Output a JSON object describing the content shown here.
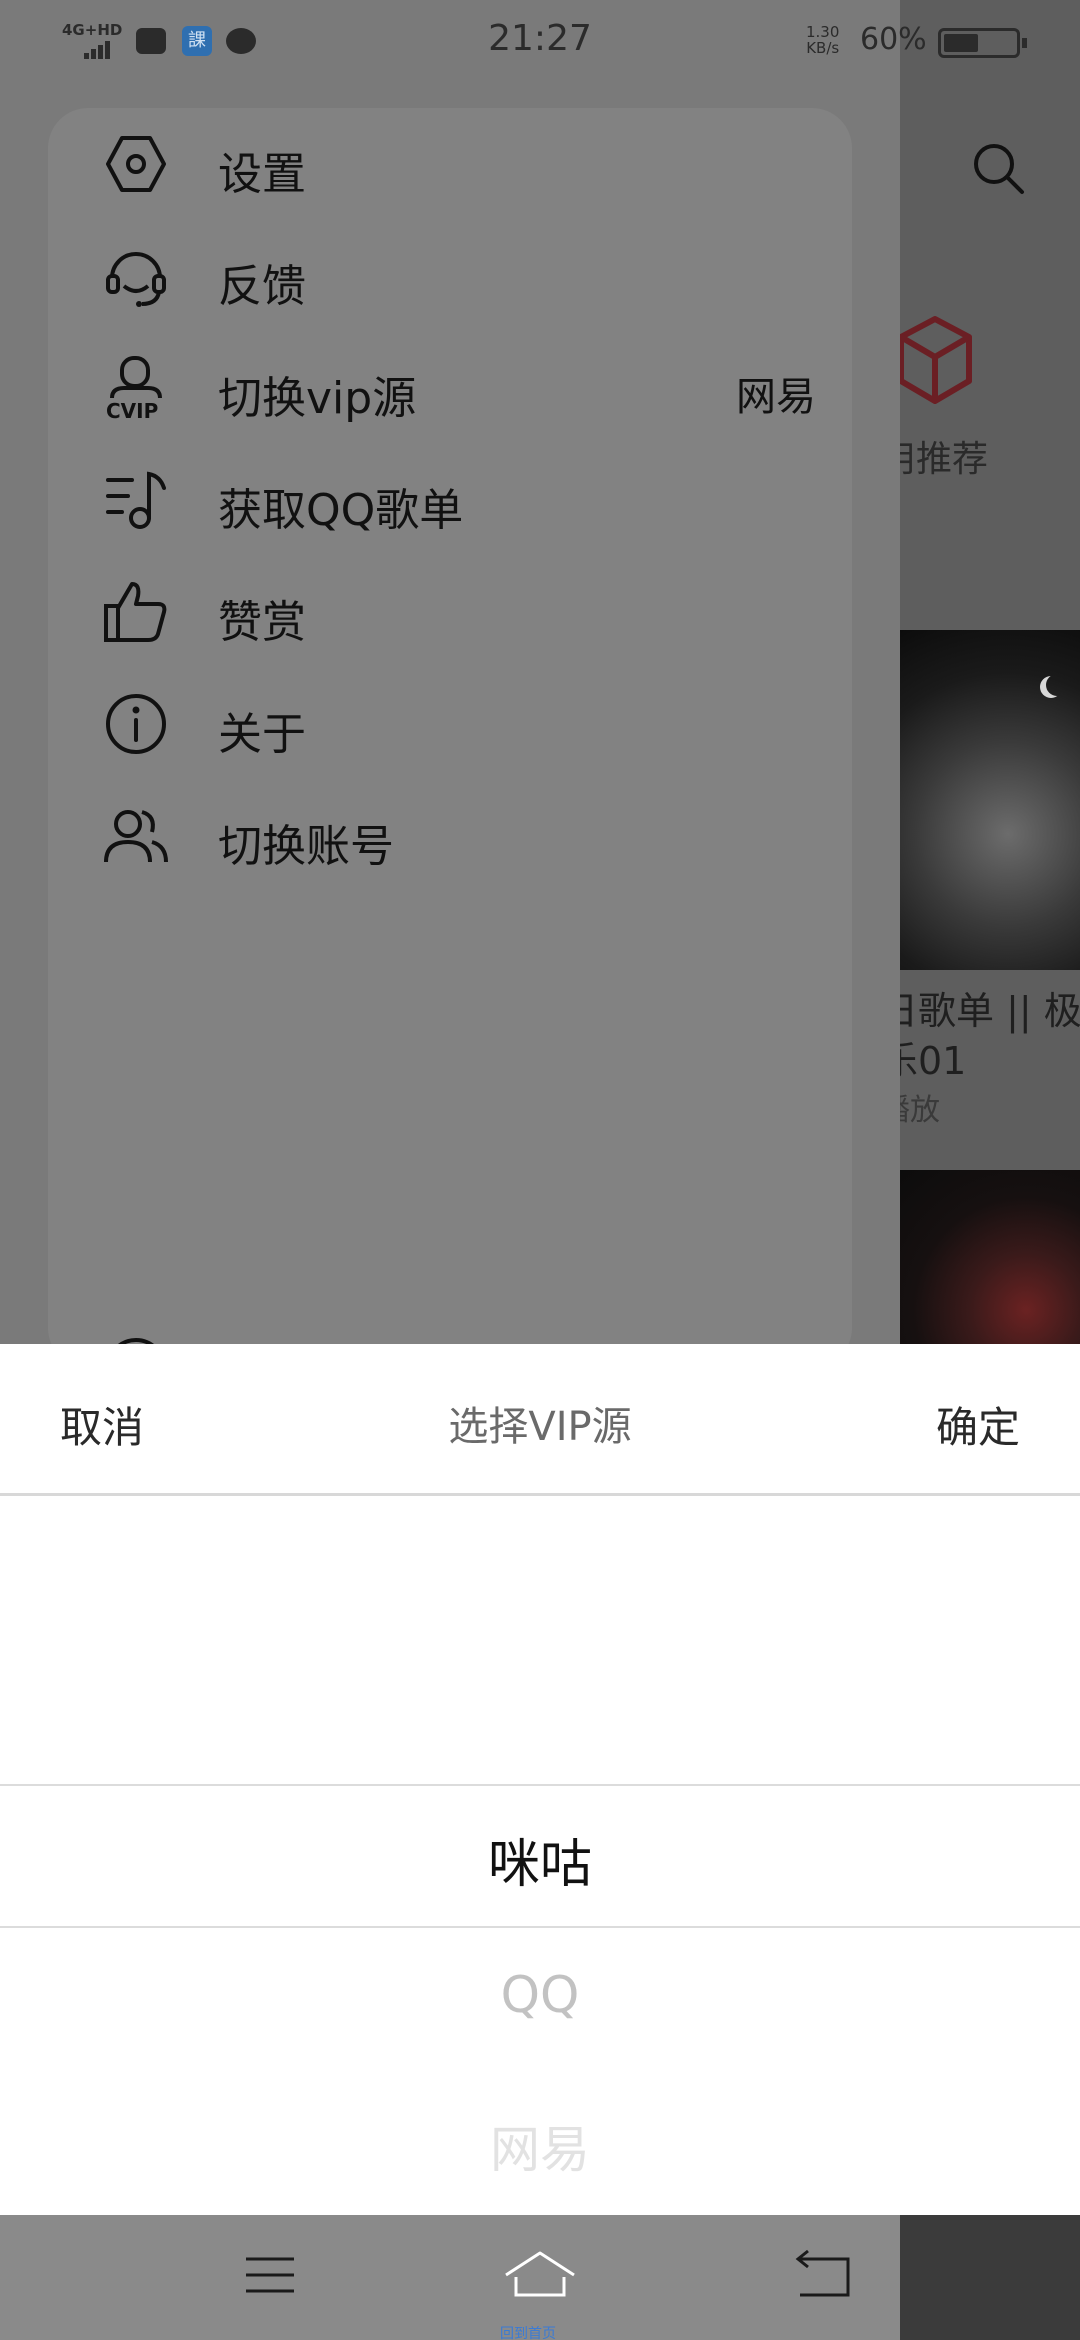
{
  "status_bar": {
    "network": "4G+HD",
    "time": "21:27",
    "speed_value": "1.30",
    "speed_unit": "KB/s",
    "battery_percent": "60%",
    "app_icon_label": "課"
  },
  "background": {
    "recommend_label": "用推荐",
    "playlist_title": "日歌单 || 极静",
    "playlist_sub": "乐01",
    "playlist_play": "播放"
  },
  "drawer": {
    "items": [
      {
        "label": "设置",
        "icon": "hexagon-settings-icon"
      },
      {
        "label": "反馈",
        "icon": "headset-icon"
      },
      {
        "label": "切换vip源",
        "icon": "vip-user-icon",
        "value": "网易"
      },
      {
        "label": "获取QQ歌单",
        "icon": "music-list-icon"
      },
      {
        "label": "赞赏",
        "icon": "thumbs-up-icon"
      },
      {
        "label": "关于",
        "icon": "info-icon"
      },
      {
        "label": "切换账号",
        "icon": "users-icon"
      }
    ]
  },
  "picker": {
    "cancel": "取消",
    "title": "选择VIP源",
    "confirm": "确定",
    "options": [
      "咪咕",
      "QQ",
      "网易"
    ],
    "selected_index": 0
  },
  "navbar": {
    "home_caption": "回到首页"
  }
}
